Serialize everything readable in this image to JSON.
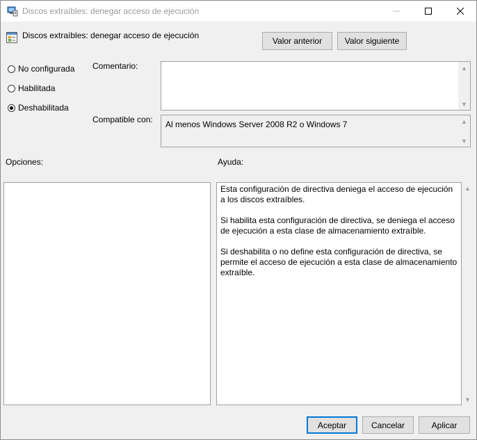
{
  "window": {
    "title": "Discos extraíbles: denegar acceso de ejecución",
    "controls": {
      "minimize": "minimize-icon",
      "maximize": "maximize-icon",
      "close": "close-icon"
    }
  },
  "header": {
    "policy_name": "Discos extraíbles: denegar acceso de ejecución",
    "prev_label": "Valor anterior",
    "next_label": "Valor siguiente"
  },
  "state": {
    "options": [
      {
        "label": "No configurada",
        "checked": false
      },
      {
        "label": "Habilitada",
        "checked": false
      },
      {
        "label": "Deshabilitada",
        "checked": true
      }
    ]
  },
  "comment": {
    "label": "Comentario:",
    "value": ""
  },
  "compatible": {
    "label": "Compatible con:",
    "value": "Al menos Windows Server 2008 R2 o Windows 7"
  },
  "options_panel": {
    "label": "Opciones:"
  },
  "help_panel": {
    "label": "Ayuda:",
    "paragraphs": [
      "Esta configuración de directiva deniega el acceso de ejecución a los discos extraíbles.",
      "Si habilita esta configuración de directiva, se deniega el acceso de ejecución a esta clase de almacenamiento extraíble.",
      "Si deshabilita o no define esta configuración de directiva, se permite el acceso de ejecución a esta clase de almacenamiento extraíble."
    ]
  },
  "footer": {
    "ok_label": "Aceptar",
    "cancel_label": "Cancelar",
    "apply_label": "Aplicar"
  },
  "colors": {
    "accent": "#0078d7",
    "window_bg": "#f0f0f0"
  }
}
